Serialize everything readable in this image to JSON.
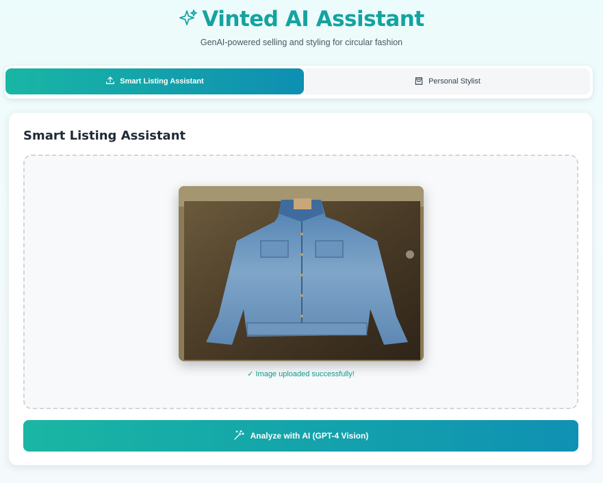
{
  "header": {
    "title": "Vinted AI Assistant",
    "subtitle": "GenAI-powered selling and styling for circular fashion"
  },
  "tabs": [
    {
      "label": "Smart Listing Assistant",
      "icon": "upload-icon",
      "active": true
    },
    {
      "label": "Personal Stylist",
      "icon": "shopping-bag-icon",
      "active": false
    }
  ],
  "listing": {
    "title": "Smart Listing Assistant",
    "upload_status": "✓ Image uploaded successfully!",
    "analyze_label": "Analyze with AI (GPT-4 Vision)"
  },
  "colors": {
    "accent": "#14a3a0",
    "gradient_start": "#19b6a4",
    "gradient_end": "#0e8fb2",
    "success": "#0f9a8a"
  }
}
